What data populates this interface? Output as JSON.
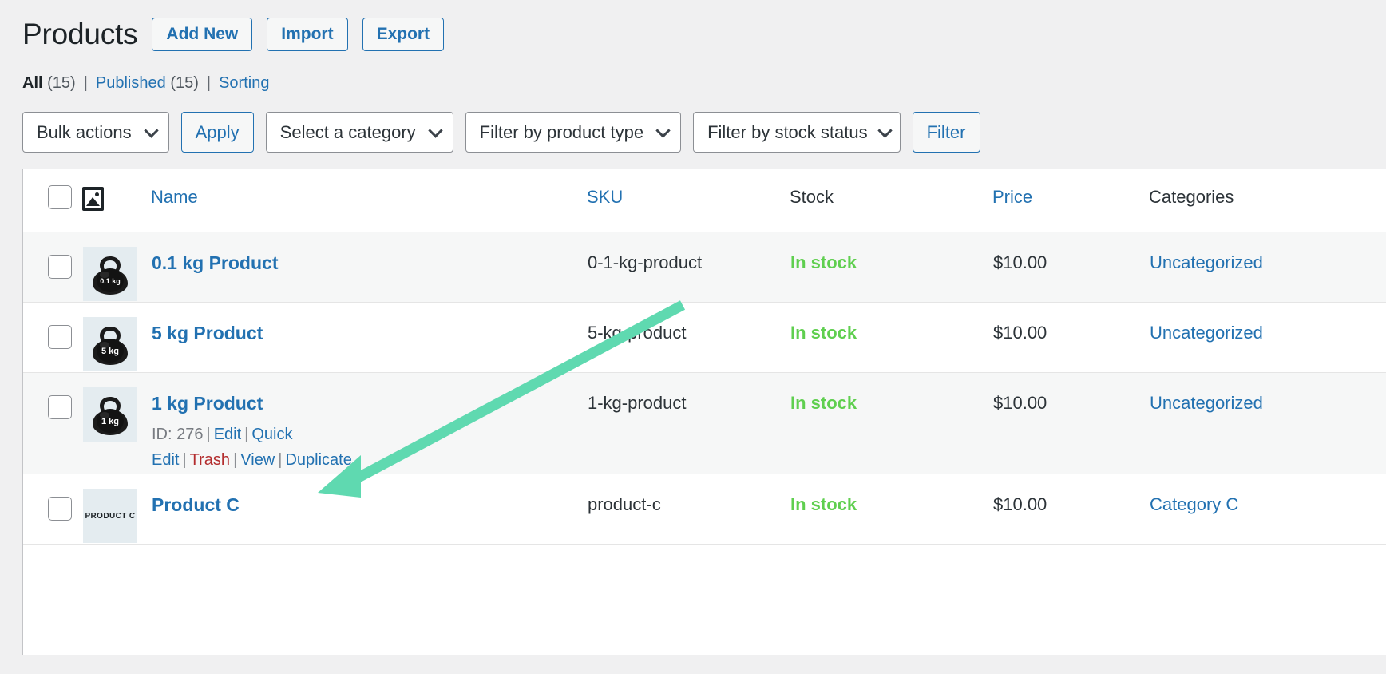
{
  "header": {
    "title": "Products",
    "buttons": [
      {
        "label": "Add New",
        "name": "add-new-button"
      },
      {
        "label": "Import",
        "name": "import-button"
      },
      {
        "label": "Export",
        "name": "export-button"
      }
    ]
  },
  "status_links": {
    "all_label": "All",
    "all_count": "(15)",
    "published_label": "Published",
    "published_count": "(15)",
    "sorting_label": "Sorting",
    "separator": "|"
  },
  "toolbar": {
    "bulk_actions": "Bulk actions",
    "apply_label": "Apply",
    "category_filter": "Select a category",
    "type_filter": "Filter by product type",
    "stock_filter": "Filter by stock status",
    "filter_label": "Filter"
  },
  "table": {
    "columns": {
      "name": "Name",
      "sku": "SKU",
      "stock": "Stock",
      "price": "Price",
      "categories": "Categories"
    },
    "rows": [
      {
        "name": "0.1 kg Product",
        "thumb_type": "kettlebell",
        "thumb_label": "0.1 kg",
        "sku": "0-1-kg-product",
        "stock": "In stock",
        "price": "$10.00",
        "category": "Uncategorized",
        "expanded": false
      },
      {
        "name": "5 kg Product",
        "thumb_type": "kettlebell",
        "thumb_label": "5 kg",
        "sku": "5-kg-product",
        "stock": "In stock",
        "price": "$10.00",
        "category": "Uncategorized",
        "expanded": false
      },
      {
        "name": "1 kg Product",
        "thumb_type": "kettlebell",
        "thumb_label": "1 kg",
        "sku": "1-kg-product",
        "stock": "In stock",
        "price": "$10.00",
        "category": "Uncategorized",
        "expanded": true,
        "actions": {
          "id": "ID: 276",
          "edit": "Edit",
          "quick_edit": "Quick Edit",
          "trash": "Trash",
          "view": "View",
          "duplicate": "Duplicate",
          "separator": "|"
        }
      },
      {
        "name": "Product C",
        "thumb_type": "text",
        "thumb_label": "PRODUCT C",
        "sku": "product-c",
        "stock": "In stock",
        "price": "$10.00",
        "category": "Category C",
        "expanded": false
      }
    ]
  },
  "annotation": {
    "arrow_color": "#5fd9b0"
  },
  "colors": {
    "link": "#2271b1",
    "in_stock": "#5fcf4f",
    "trash": "#b32d2e",
    "page_bg": "#f0f0f1",
    "row_alt": "#f6f7f7"
  }
}
